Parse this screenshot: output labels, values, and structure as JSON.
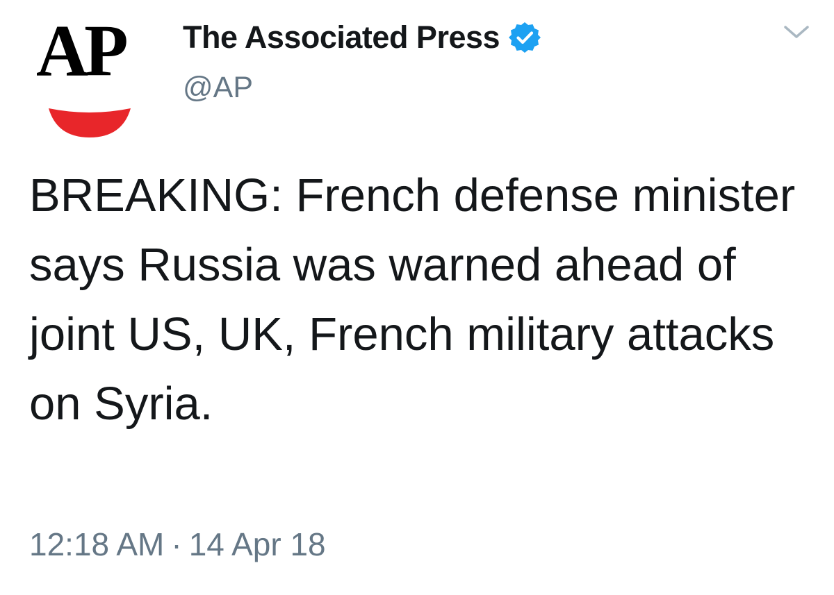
{
  "account": {
    "avatar_text": "AP",
    "display_name": "The Associated Press",
    "handle": "@AP",
    "verified": true
  },
  "tweet": {
    "text": "BREAKING: French defense minister says Russia was warned ahead of joint US, UK, French military attacks on Syria.",
    "time": "12:18 AM",
    "separator": "·",
    "date": "14 Apr 18"
  },
  "icons": {
    "verified": "verified-badge-icon",
    "menu": "chevron-down-icon"
  },
  "colors": {
    "verified_blue": "#1da1f2",
    "secondary_text": "#657786",
    "primary_text": "#14171a",
    "ap_red": "#e8262a",
    "caret": "#aab8c2"
  }
}
